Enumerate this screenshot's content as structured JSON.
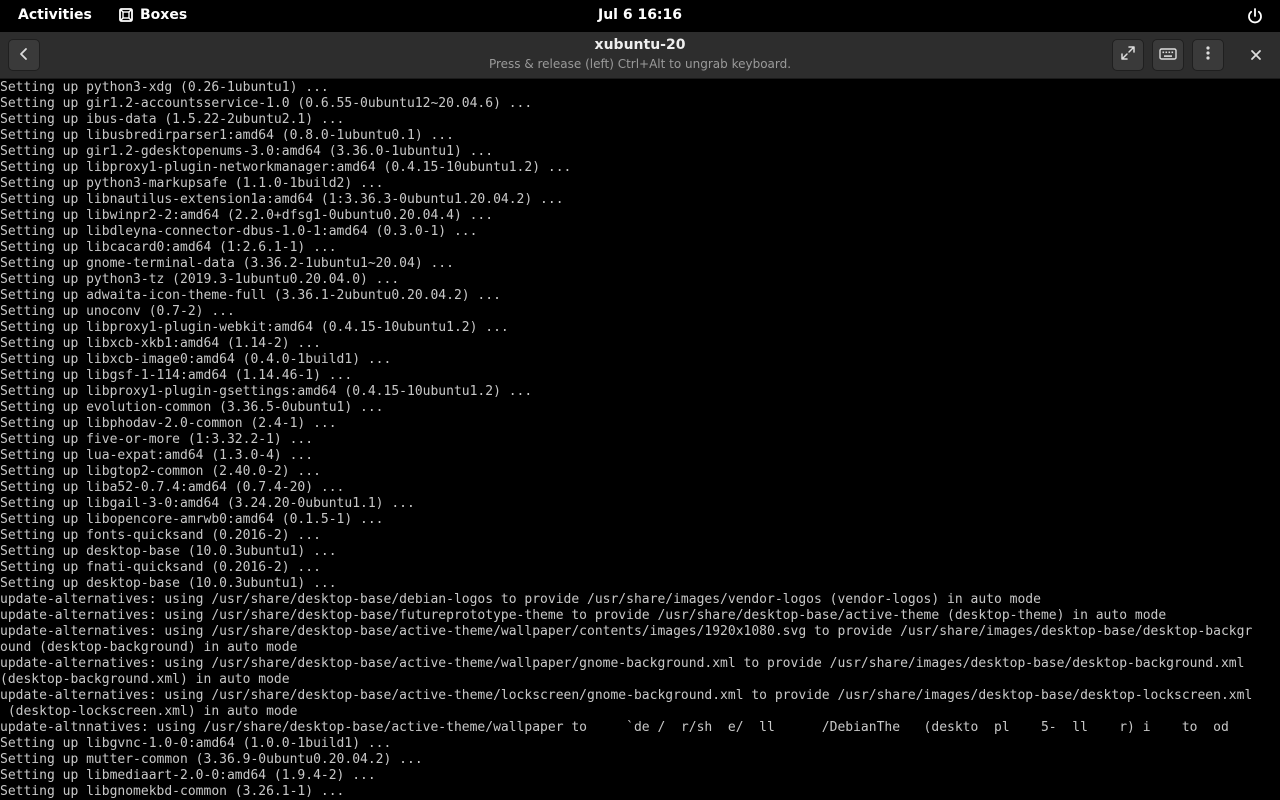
{
  "topbar": {
    "activities": "Activities",
    "app_name": "Boxes",
    "clock": "Jul 6  16:16"
  },
  "headerbar": {
    "title": "xubuntu-20",
    "subtitle": "Press & release (left) Ctrl+Alt to ungrab keyboard."
  },
  "terminal_lines": [
    "Setting up python3-xdg (0.26-1ubuntu1) ...",
    "Setting up gir1.2-accountsservice-1.0 (0.6.55-0ubuntu12~20.04.6) ...",
    "Setting up ibus-data (1.5.22-2ubuntu2.1) ...",
    "Setting up libusbredirparser1:amd64 (0.8.0-1ubuntu0.1) ...",
    "Setting up gir1.2-gdesktopenums-3.0:amd64 (3.36.0-1ubuntu1) ...",
    "Setting up libproxy1-plugin-networkmanager:amd64 (0.4.15-10ubuntu1.2) ...",
    "Setting up python3-markupsafe (1.1.0-1build2) ...",
    "Setting up libnautilus-extension1a:amd64 (1:3.36.3-0ubuntu1.20.04.2) ...",
    "Setting up libwinpr2-2:amd64 (2.2.0+dfsg1-0ubuntu0.20.04.4) ...",
    "Setting up libdleyna-connector-dbus-1.0-1:amd64 (0.3.0-1) ...",
    "Setting up libcacard0:amd64 (1:2.6.1-1) ...",
    "Setting up gnome-terminal-data (3.36.2-1ubuntu1~20.04) ...",
    "Setting up python3-tz (2019.3-1ubuntu0.20.04.0) ...",
    "Setting up adwaita-icon-theme-full (3.36.1-2ubuntu0.20.04.2) ...",
    "Setting up unoconv (0.7-2) ...",
    "Setting up libproxy1-plugin-webkit:amd64 (0.4.15-10ubuntu1.2) ...",
    "Setting up libxcb-xkb1:amd64 (1.14-2) ...",
    "Setting up libxcb-image0:amd64 (0.4.0-1build1) ...",
    "Setting up libgsf-1-114:amd64 (1.14.46-1) ...",
    "Setting up libproxy1-plugin-gsettings:amd64 (0.4.15-10ubuntu1.2) ...",
    "Setting up evolution-common (3.36.5-0ubuntu1) ...",
    "Setting up libphodav-2.0-common (2.4-1) ...",
    "Setting up five-or-more (1:3.32.2-1) ...",
    "Setting up lua-expat:amd64 (1.3.0-4) ...",
    "Setting up libgtop2-common (2.40.0-2) ...",
    "Setting up liba52-0.7.4:amd64 (0.7.4-20) ...",
    "Setting up libgail-3-0:amd64 (3.24.20-0ubuntu1.1) ...",
    "Setting up libopencore-amrwb0:amd64 (0.1.5-1) ...",
    "Setting up fonts-quicksand (0.2016-2) ...",
    "Setting up desktop-base (10.0.3ubuntu1) ...",
    "Setting up fnati-quicksand (0.2016-2) ...",
    "Setting up desktop-base (10.0.3ubuntu1) ...",
    "update-alternatives: using /usr/share/desktop-base/debian-logos to provide /usr/share/images/vendor-logos (vendor-logos) in auto mode",
    "update-alternatives: using /usr/share/desktop-base/futureprototype-theme to provide /usr/share/desktop-base/active-theme (desktop-theme) in auto mode",
    "update-alternatives: using /usr/share/desktop-base/active-theme/wallpaper/contents/images/1920x1080.svg to provide /usr/share/images/desktop-base/desktop-backgr",
    "ound (desktop-background) in auto mode",
    "update-alternatives: using /usr/share/desktop-base/active-theme/wallpaper/gnome-background.xml to provide /usr/share/images/desktop-base/desktop-background.xml",
    "(desktop-background.xml) in auto mode",
    "update-alternatives: using /usr/share/desktop-base/active-theme/lockscreen/gnome-background.xml to provide /usr/share/images/desktop-base/desktop-lockscreen.xml",
    " (desktop-lockscreen.xml) in auto mode",
    "update-altnnatives: using /usr/share/desktop-base/active-theme/wallpaper to     `de /  r/sh  e/  ll      /DebianThe   (deskto  pl    5-  ll    r) i    to  od",
    "Setting up libgvnc-1.0-0:amd64 (1.0.0-1build1) ...",
    "Setting up mutter-common (3.36.9-0ubuntu0.20.04.2) ...",
    "Setting up libmediaart-2.0-0:amd64 (1.9.4-2) ...",
    "Setting up libgnomekbd-common (3.26.1-1) ..."
  ]
}
